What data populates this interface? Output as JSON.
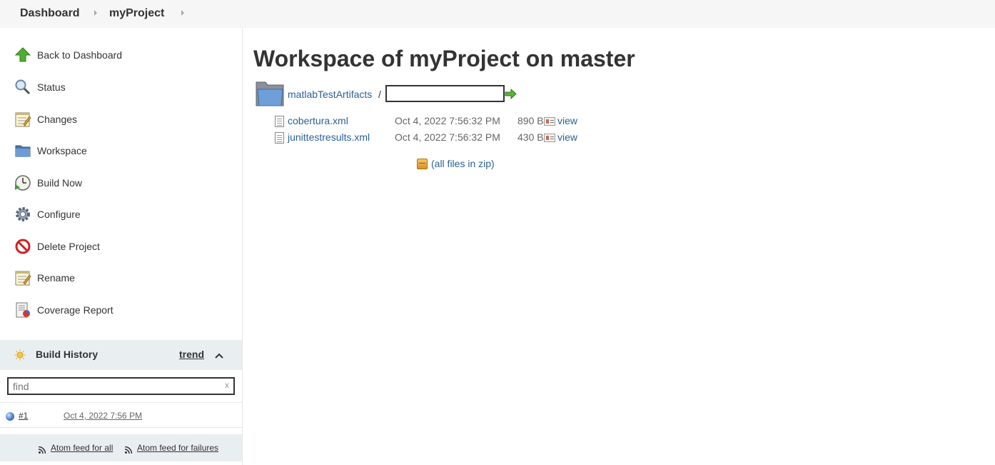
{
  "breadcrumbs": [
    "Dashboard",
    "myProject"
  ],
  "sidebar": {
    "tasks": [
      {
        "label": "Back to Dashboard",
        "icon": "up-arrow-icon"
      },
      {
        "label": "Status",
        "icon": "magnifier-icon"
      },
      {
        "label": "Changes",
        "icon": "notepad-icon"
      },
      {
        "label": "Workspace",
        "icon": "folder-icon"
      },
      {
        "label": "Build Now",
        "icon": "clock-icon"
      },
      {
        "label": "Configure",
        "icon": "gear-icon"
      },
      {
        "label": "Delete Project",
        "icon": "no-entry-icon"
      },
      {
        "label": "Rename",
        "icon": "notepad-icon"
      },
      {
        "label": "Coverage Report",
        "icon": "report-icon"
      }
    ],
    "build_history": {
      "title": "Build History",
      "trend_label": "trend",
      "find_placeholder": "find",
      "find_clear": "x",
      "builds": [
        {
          "number": "#1",
          "date": "Oct 4, 2022 7:56 PM"
        }
      ],
      "feeds": [
        "Atom feed for all",
        "Atom feed for failures"
      ]
    }
  },
  "main": {
    "title": "Workspace of myProject on master",
    "path": {
      "folder": "matlabTestArtifacts",
      "separator": "/"
    },
    "files": [
      {
        "name": "cobertura.xml",
        "date": "Oct 4, 2022 7:56:32 PM",
        "size": "890 B",
        "view": "view"
      },
      {
        "name": "junittestresults.xml",
        "date": "Oct 4, 2022 7:56:32 PM",
        "size": "430 B",
        "view": "view"
      }
    ],
    "zip_label": "(all files in zip)"
  },
  "colors": {
    "link": "#2a6195",
    "sidebar_header_bg": "#e9eef1",
    "topbar_bg": "#f6f6f6"
  }
}
